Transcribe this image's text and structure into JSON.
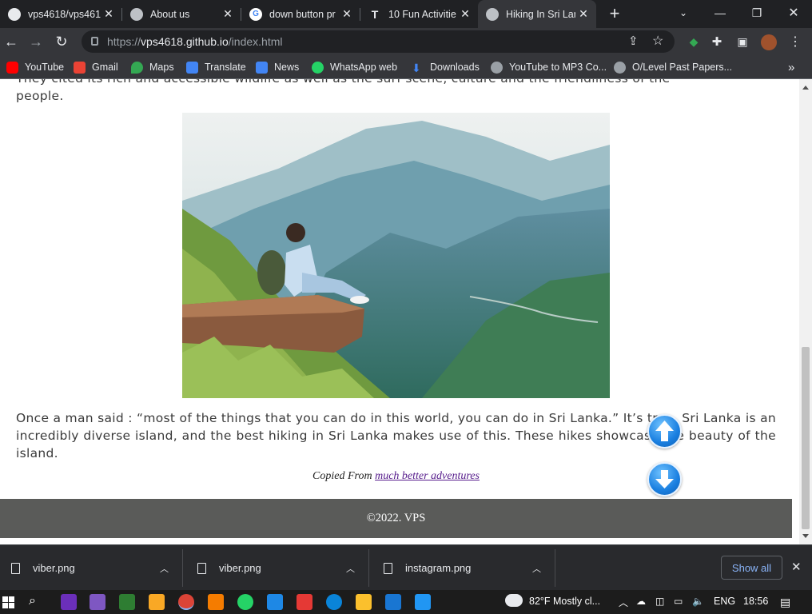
{
  "colors": {
    "chrome_dark": "#202124",
    "chrome_toolbar": "#35363a",
    "footer_bg": "#5a5b59",
    "link_visited": "#551a8b",
    "accent_blue": "#1a7fe0"
  },
  "tabs": [
    {
      "title": "vps4618/vps461",
      "icon": "github-icon"
    },
    {
      "title": "About us",
      "icon": "globe-icon"
    },
    {
      "title": "down button pr",
      "icon": "google-icon"
    },
    {
      "title": "10 Fun Activitie",
      "icon": "site-t-icon"
    },
    {
      "title": "Hiking In Sri Lan",
      "icon": "globe-icon",
      "active": true
    }
  ],
  "toolbar": {
    "url_prefix": "https://",
    "url_host": "vps4618.github.io",
    "url_path": "/index.html"
  },
  "bookmarks": [
    {
      "label": "YouTube",
      "icon": "youtube-icon",
      "color": "#ff0000"
    },
    {
      "label": "Gmail",
      "icon": "gmail-icon",
      "color": "#ea4335"
    },
    {
      "label": "Maps",
      "icon": "maps-icon",
      "color": "#34a853"
    },
    {
      "label": "Translate",
      "icon": "translate-icon",
      "color": "#4285f4"
    },
    {
      "label": "News",
      "icon": "news-icon",
      "color": "#4285f4"
    },
    {
      "label": "WhatsApp web",
      "icon": "whatsapp-icon",
      "color": "#25d366"
    },
    {
      "label": "Downloads",
      "icon": "download-icon",
      "color": "#4285f4"
    },
    {
      "label": "YouTube to MP3 Co...",
      "icon": "globe-icon",
      "color": "#9aa0a6"
    },
    {
      "label": "O/Level Past Papers...",
      "icon": "globe-icon",
      "color": "#9aa0a6"
    }
  ],
  "content": {
    "intro_cut_line": "They cited its rich and accessible wildlife as well as the surf scene, culture and the friendliness of the",
    "intro_last_line": "people.",
    "quote_paragraph": "Once a man said : “most of the things that you can do in this world, you can do in Sri Lanka.” It’s true. Sri Lanka is an incredibly diverse island, and the best hiking in Sri Lanka makes use of this. These hikes showcase the beauty of the island.",
    "copied_prefix": "Copied From",
    "copied_link": "much better adventures",
    "footer": "©2022. VPS"
  },
  "downloads": [
    {
      "name": "viber.png"
    },
    {
      "name": "viber.png"
    },
    {
      "name": "instagram.png"
    }
  ],
  "downloads_show_all": "Show all",
  "taskbar": {
    "weather": "82°F  Mostly cl...",
    "language": "ENG",
    "time": "18:56"
  }
}
